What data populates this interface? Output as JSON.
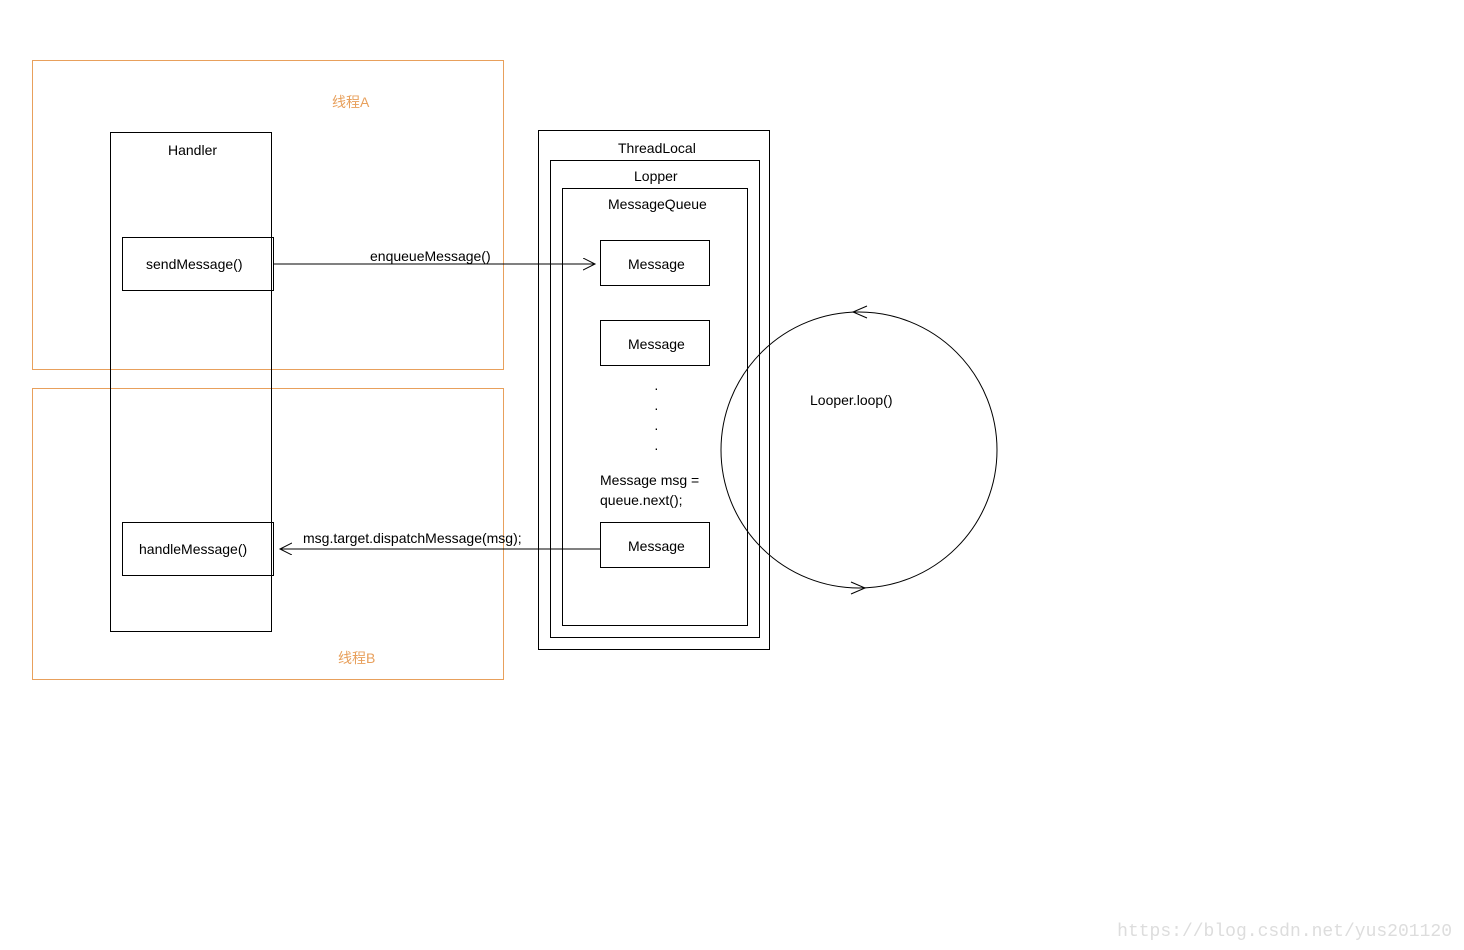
{
  "threadA": {
    "title": "线程A"
  },
  "threadB": {
    "title": "线程B"
  },
  "handler": {
    "title": "Handler",
    "sendMessage": "sendMessage()",
    "handleMessage": "handleMessage()"
  },
  "threadLocal": {
    "title": "ThreadLocal",
    "looper": {
      "title": "Lopper",
      "messageQueue": {
        "title": "MessageQueue",
        "msg1": "Message",
        "msg2": "Message",
        "dots": "·\n·\n·\n·",
        "dequeueLabel": "Message msg = queue.next();",
        "msgLast": "Message"
      }
    }
  },
  "arrows": {
    "enqueueMessage": "enqueueMessage()",
    "dispatchMessage": "msg.target.dispatchMessage(msg);"
  },
  "loop": {
    "label": "Looper.loop()"
  },
  "watermark": "https://blog.csdn.net/yus201120"
}
